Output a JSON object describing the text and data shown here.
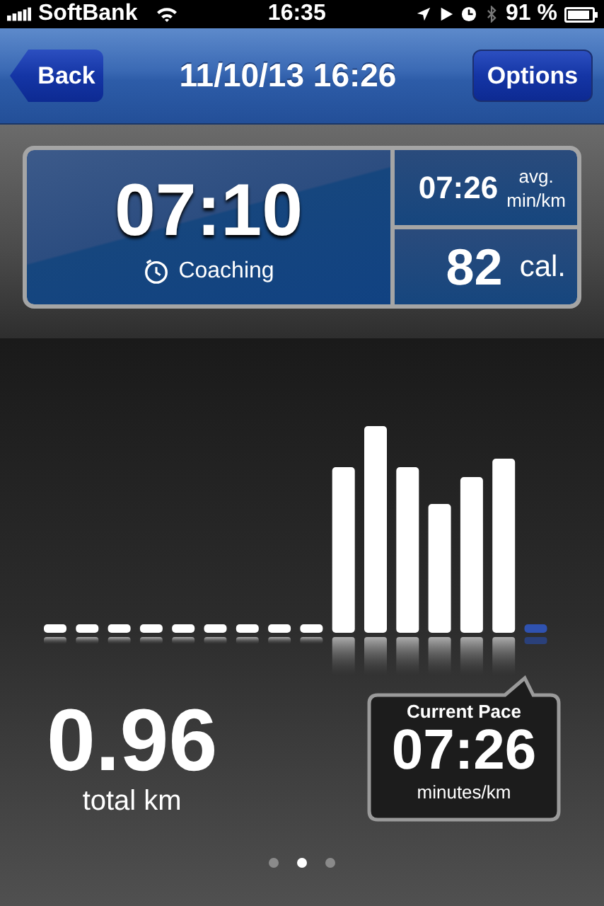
{
  "status_bar": {
    "carrier": "SoftBank",
    "time": "16:35",
    "battery": "91 %"
  },
  "nav_bar": {
    "back": "Back",
    "title": "11/10/13 16:26",
    "options": "Options"
  },
  "stats": {
    "duration": "07:10",
    "coaching": "Coaching",
    "avg_pace": "07:26",
    "avg_label": "avg.",
    "avg_unit": "min/km",
    "calories": "82",
    "calories_unit": "cal."
  },
  "distance": {
    "value": "0.96",
    "unit": "total km"
  },
  "current_pace": {
    "title": "Current Pace",
    "value": "07:26",
    "unit": "minutes/km"
  },
  "pages": [
    {
      "selected": false
    },
    {
      "selected": true
    },
    {
      "selected": false
    }
  ]
}
